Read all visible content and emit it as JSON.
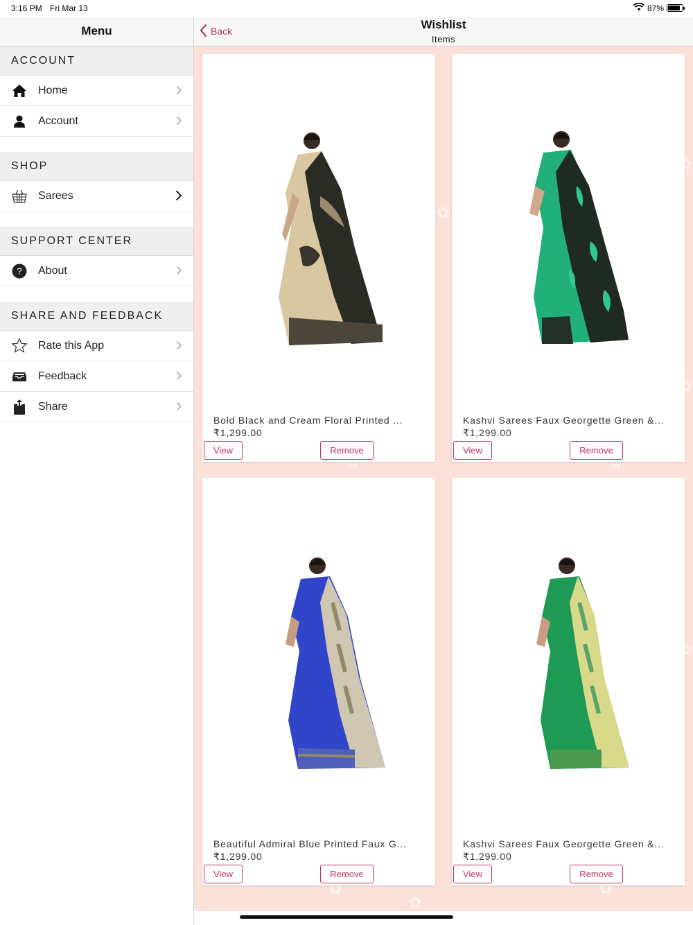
{
  "status_bar": {
    "time": "3:16 PM",
    "date": "Fri Mar 13",
    "battery": "87%",
    "battery_level": 0.87,
    "icons": [
      "wifi-icon",
      "battery-icon"
    ]
  },
  "sidebar": {
    "title": "Menu",
    "sections": [
      {
        "heading": "ACCOUNT",
        "items": [
          {
            "label": "Home",
            "icon": "home-icon"
          },
          {
            "label": "Account",
            "icon": "user-icon"
          }
        ]
      },
      {
        "heading": "SHOP",
        "items": [
          {
            "label": "Sarees",
            "icon": "basket-icon"
          }
        ]
      },
      {
        "heading": "SUPPORT CENTER",
        "items": [
          {
            "label": "About",
            "icon": "question-icon"
          }
        ]
      },
      {
        "heading": "SHARE AND FEEDBACK",
        "items": [
          {
            "label": "Rate this App",
            "icon": "star-icon"
          },
          {
            "label": "Feedback",
            "icon": "inbox-icon"
          },
          {
            "label": "Share",
            "icon": "share-icon"
          }
        ]
      }
    ]
  },
  "navbar": {
    "back_label": "Back",
    "title": "Wishlist",
    "subtitle": "Items"
  },
  "products": [
    {
      "name": "Bold Black and Cream Floral Printed ...",
      "price": "₹1,299.00",
      "view_label": "View",
      "remove_label": "Remove",
      "colors": {
        "main": "#2b2b26",
        "accent": "#d8c7a0"
      }
    },
    {
      "name": "Kashvi Sarees Faux Georgette Green &...",
      "price": "₹1,299.00",
      "view_label": "View",
      "remove_label": "Remove",
      "colors": {
        "main": "#1f2a22",
        "accent": "#22b07a"
      }
    },
    {
      "name": "Beautiful Admiral Blue Printed Faux G...",
      "price": "₹1,299.00",
      "view_label": "View",
      "remove_label": "Remove",
      "colors": {
        "main": "#3145c8",
        "accent": "#cfc7b2"
      }
    },
    {
      "name": "Kashvi Sarees Faux Georgette Green &...",
      "price": "₹1,299.00",
      "view_label": "View",
      "remove_label": "Remove",
      "colors": {
        "main": "#1e9a55",
        "accent": "#d9d98a"
      }
    }
  ],
  "theme": {
    "accent": "#c2306a",
    "back_color": "#b03a6f",
    "content_background": "#fbe1d8"
  }
}
